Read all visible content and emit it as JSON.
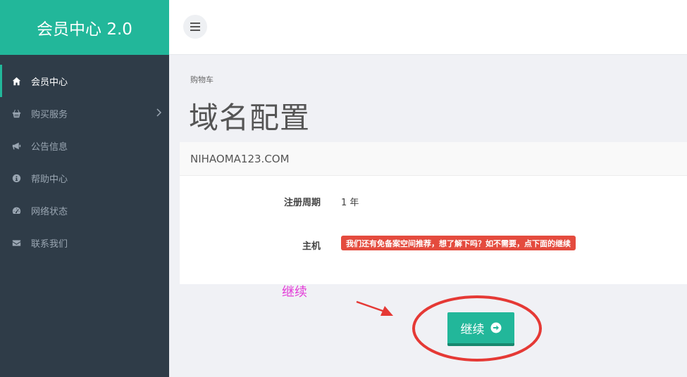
{
  "sidebar": {
    "brand": "会员中心 2.0",
    "items": [
      {
        "label": "会员中心",
        "icon": "home-icon",
        "active": true
      },
      {
        "label": "购买服务",
        "icon": "basket-icon"
      },
      {
        "label": "公告信息",
        "icon": "bullhorn-icon"
      },
      {
        "label": "帮助中心",
        "icon": "info-icon"
      },
      {
        "label": "网络状态",
        "icon": "dashboard-icon"
      },
      {
        "label": "联系我们",
        "icon": "envelope-icon"
      }
    ]
  },
  "header": {
    "menu_icon": "hamburger-icon"
  },
  "main": {
    "breadcrumb": "购物车",
    "title": "域名配置",
    "card": {
      "domain": "NIHAOMA123.COM",
      "period_label": "注册周期",
      "period_value": "1 年",
      "host_label": "主机",
      "host_notice": "我们还有免备案空间推荐，想了解下吗？如不需要，点下面的继续"
    },
    "continue_label": "继续"
  },
  "annotation": {
    "label": "继续",
    "color": "#e33ad8",
    "circle_color": "#e53935"
  },
  "colors": {
    "accent": "#22b79a",
    "sidebar_bg": "#2f3c48",
    "badge": "#e44b3e"
  }
}
